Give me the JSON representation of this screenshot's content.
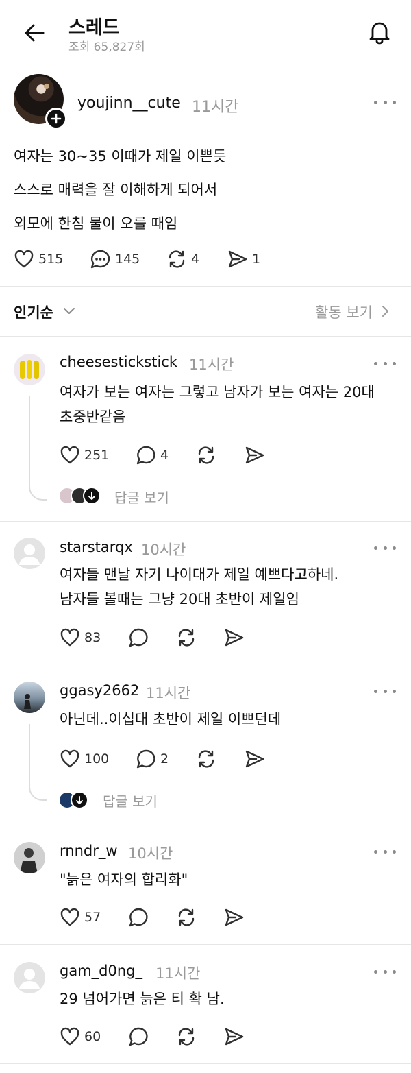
{
  "header": {
    "title": "스레드",
    "views": "조회 65,827회"
  },
  "post": {
    "username": "youjinn__cute",
    "time": "11시간",
    "lines": [
      "여자는 30~35 이때가 제일 이쁜듯",
      "스스로 매력을 잘 이해하게 되어서",
      "외모에 한침 물이 오를 때임"
    ],
    "likes": "515",
    "comments": "145",
    "reposts": "4",
    "shares": "1"
  },
  "sort": {
    "label": "인기순",
    "activity": "활동 보기"
  },
  "comments": [
    {
      "username": "cheesestickstick",
      "time": "11시간",
      "lines": [
        "여자가 보는 여자는 그렇고 남자가 보는 여자는 20대",
        "초중반같음"
      ],
      "likes": "251",
      "replies": "4",
      "view_replies": "답글 보기"
    },
    {
      "username": "starstarqx",
      "time": "10시간",
      "lines": [
        "여자들 맨날 자기 나이대가 제일 예쁘다고하네.",
        "남자들 볼때는 그냥 20대 초반이 제일임"
      ],
      "likes": "83"
    },
    {
      "username": "ggasy2662",
      "time": "11시간",
      "lines": [
        "아닌데..이십대 초반이 제일 이쁘던데"
      ],
      "likes": "100",
      "replies": "2",
      "view_replies": "답글 보기"
    },
    {
      "username": "rnndr_w",
      "time": "10시간",
      "lines": [
        "\"늙은 여자의 합리화\""
      ],
      "likes": "57"
    },
    {
      "username": "gam_d0ng_",
      "time": "11시간",
      "lines": [
        "29 넘어가면 늙은 티 확 남."
      ],
      "likes": "60"
    }
  ],
  "icons": {
    "back": "arrow-left-icon",
    "bell": "bell-icon",
    "like": "heart-icon",
    "comment": "speech-bubble-icon",
    "repost": "repost-icon",
    "share": "paper-plane-icon",
    "more": "more-dots-icon"
  },
  "colors": {
    "text": "#101010",
    "muted": "#9a9a9a",
    "divider": "#e6e6e6"
  }
}
